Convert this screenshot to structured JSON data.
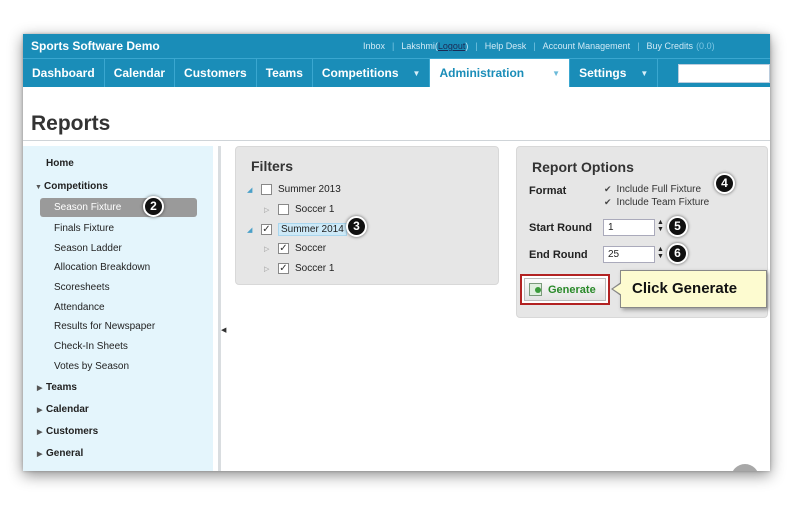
{
  "app": {
    "title": "Sports Software Demo",
    "links": {
      "inbox": "Inbox",
      "user": "Lakshmi",
      "logout": "Logout",
      "help": "Help Desk",
      "account": "Account Management",
      "credits": "Buy Credits",
      "credits_value": "(0.0)"
    }
  },
  "nav": {
    "items": [
      {
        "label": "Dashboard"
      },
      {
        "label": "Calendar"
      },
      {
        "label": "Customers"
      },
      {
        "label": "Teams"
      },
      {
        "label": "Competitions"
      },
      {
        "label": "Administration"
      },
      {
        "label": "Settings"
      }
    ]
  },
  "page": {
    "title": "Reports"
  },
  "sidebar": {
    "home": "Home",
    "competitions": "Competitions",
    "items": [
      "Season Fixture",
      "Finals Fixture",
      "Season Ladder",
      "Allocation Breakdown",
      "Scoresheets",
      "Attendance",
      "Results for Newspaper",
      "Check-In Sheets",
      "Votes by Season"
    ],
    "teams": "Teams",
    "calendar": "Calendar",
    "customers": "Customers",
    "general": "General"
  },
  "filters": {
    "title": "Filters",
    "tree": [
      {
        "label": "Summer 2013",
        "checked": false
      },
      {
        "label": "Soccer 1",
        "checked": false
      },
      {
        "label": "Summer 2014",
        "checked": true
      },
      {
        "label": "Soccer",
        "checked": true
      },
      {
        "label": "Soccer 1",
        "checked": true
      }
    ]
  },
  "report_options": {
    "title": "Report Options",
    "format_label": "Format",
    "include_full": "Include Full Fixture",
    "include_team": "Include Team Fixture",
    "start_round_label": "Start Round",
    "start_round_value": "1",
    "end_round_label": "End Round",
    "end_round_value": "25",
    "generate_label": "Generate"
  },
  "callout": {
    "text": "Click Generate"
  },
  "badges": {
    "b2": "2",
    "b3": "3",
    "b4": "4",
    "b5": "5",
    "b6": "6"
  }
}
